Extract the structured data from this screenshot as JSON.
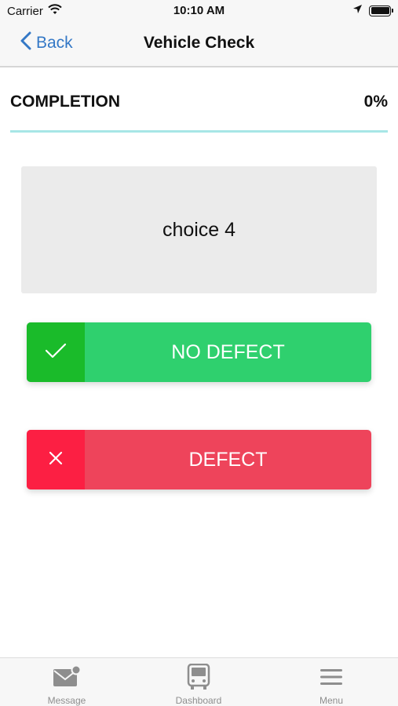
{
  "status_bar": {
    "carrier": "Carrier",
    "time": "10:10 AM"
  },
  "nav": {
    "back_label": "Back",
    "title": "Vehicle Check"
  },
  "completion": {
    "label": "COMPLETION",
    "value": "0%",
    "progress_fraction": 0.0
  },
  "choice": {
    "text": "choice 4"
  },
  "actions": {
    "no_defect_label": "NO DEFECT",
    "defect_label": "DEFECT"
  },
  "tab_bar": {
    "items": [
      {
        "label": "Message",
        "icon": "message-icon"
      },
      {
        "label": "Dashboard",
        "icon": "bus-icon"
      },
      {
        "label": "Menu",
        "icon": "hamburger-menu-icon"
      }
    ]
  },
  "colors": {
    "accent_blue": "#3478c6",
    "progress_track": "#a7e6e6",
    "no_defect_green": "#2fd06e",
    "no_defect_icon_green": "#1abb2a",
    "defect_red": "#ee445b",
    "defect_icon_red": "#fc1f43",
    "tab_gray": "#8e8e8e"
  }
}
